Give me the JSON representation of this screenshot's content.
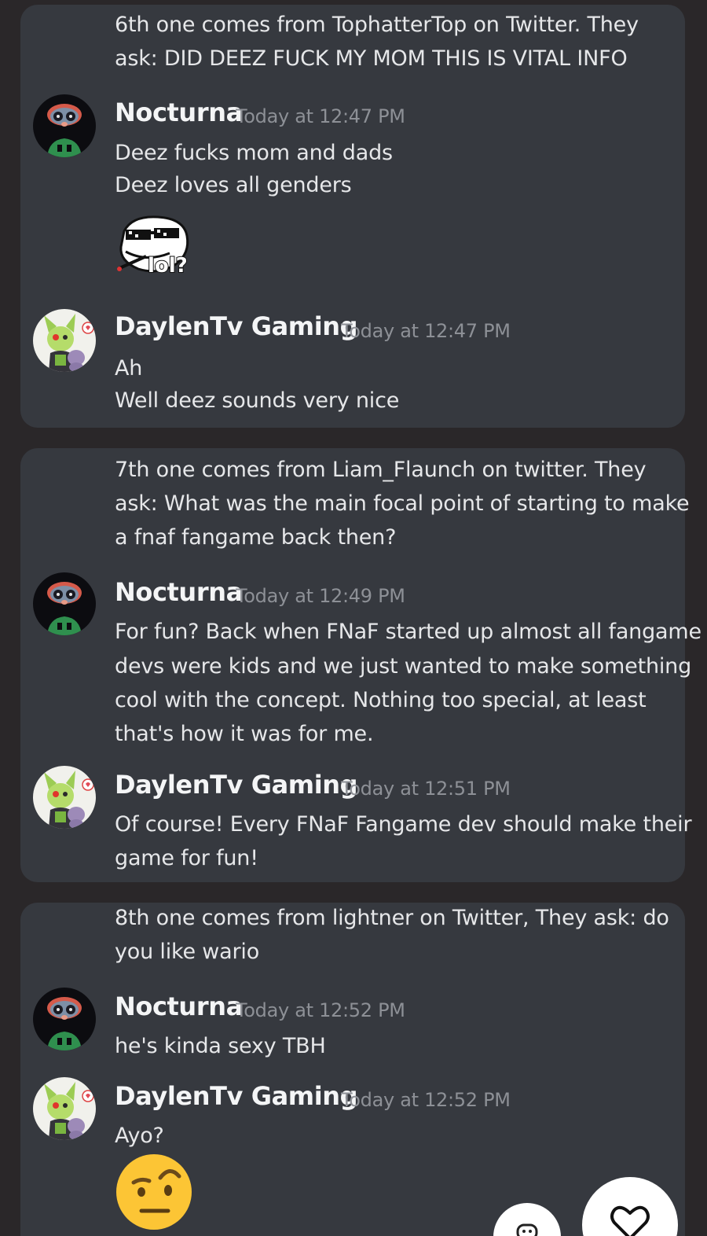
{
  "messages": {
    "q6_line1": "6th one comes from TophatterTop on Twitter. They",
    "q6_line2": "ask: DID DEEZ FUCK MY MOM THIS IS VITAL INFO",
    "n1_name": "Nocturna",
    "n1_time": "Today at 12:47 PM",
    "n1_line1": "Deez fucks mom and dads",
    "n1_line2": "Deez loves all genders",
    "sticker_text": "lol?",
    "d1_name": "DaylenTv Gaming",
    "d1_time": "Today at 12:47 PM",
    "d1_line1": "Ah",
    "d1_line2": "Well deez sounds very nice",
    "q7_line1": "7th one comes from Liam_Flaunch on twitter. They",
    "q7_line2": "ask: What was the main focal point of starting to make",
    "q7_line3": "a fnaf fangame back then?",
    "n2_name": "Nocturna",
    "n2_time": "Today at 12:49 PM",
    "n2_line1": "For fun? Back when FNaF started up almost all fangame",
    "n2_line2": "devs were kids and we just wanted to make something",
    "n2_line3": "cool with the concept. Nothing too special, at least",
    "n2_line4": "that's how it was for me.",
    "d2_name": "DaylenTv Gaming",
    "d2_time": "Today at 12:51 PM",
    "d2_line1": "Of course! Every FNaF Fangame dev should make their",
    "d2_line2": "game for fun!",
    "q8_line1": "8th one comes from lightner on Twitter, They ask: do",
    "q8_line2": "you like wario",
    "n3_name": "Nocturna",
    "n3_time": "Today at 12:52 PM",
    "n3_line1": "he's kinda sexy TBH",
    "d3_name": "DaylenTv Gaming",
    "d3_time": "Today at 12:52 PM",
    "d3_line1": "Ayo?"
  },
  "icons": {
    "nocturna_avatar": "nocturna-avatar",
    "daylen_avatar": "daylen-avatar",
    "troll_sticker": "trollface-sunglasses-sticker",
    "raised_eyebrow_emoji": "face-with-raised-eyebrow-emoji",
    "like_button": "heart-icon",
    "reaction_button": "add-reaction-icon"
  },
  "colors": {
    "card_bg": "#36393f",
    "page_bg": "#2a2729",
    "timestamp": "#8d9096"
  }
}
